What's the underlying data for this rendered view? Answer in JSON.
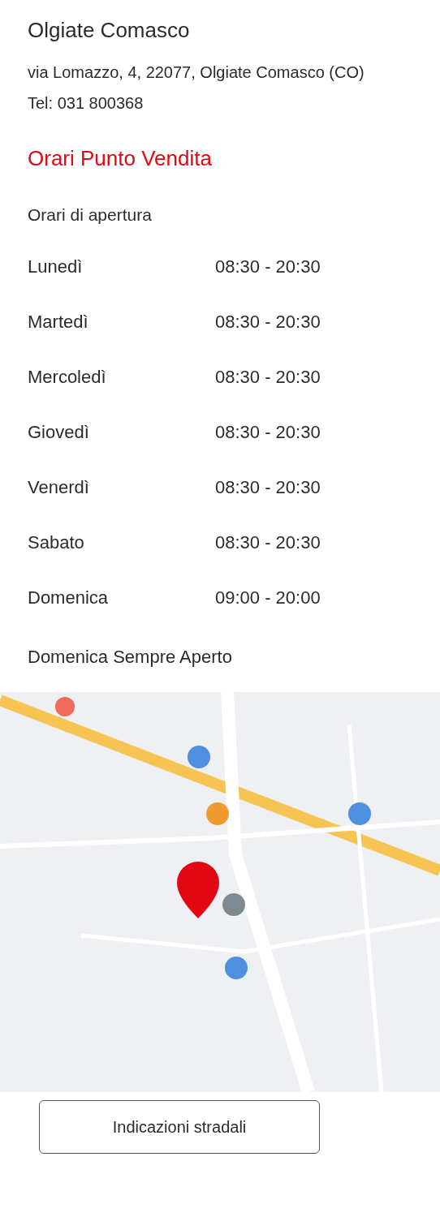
{
  "store": {
    "name": "Olgiate Comasco",
    "address": "via Lomazzo, 4, 22077, Olgiate Comasco (CO)",
    "phone": "Tel: 031 800368"
  },
  "hours": {
    "heading": "Orari Punto Vendita",
    "subheading": "Orari di apertura",
    "days": [
      {
        "day": "Lunedì",
        "time": "08:30 - 20:30"
      },
      {
        "day": "Martedì",
        "time": "08:30 - 20:30"
      },
      {
        "day": "Mercoledì",
        "time": "08:30 - 20:30"
      },
      {
        "day": "Giovedì",
        "time": "08:30 - 20:30"
      },
      {
        "day": "Venerdì",
        "time": "08:30 - 20:30"
      },
      {
        "day": "Sabato",
        "time": "08:30 - 20:30"
      },
      {
        "day": "Domenica",
        "time": "09:00 - 20:00"
      }
    ],
    "note": "Domenica Sempre Aperto"
  },
  "directions_button": "Indicazioni stradali"
}
